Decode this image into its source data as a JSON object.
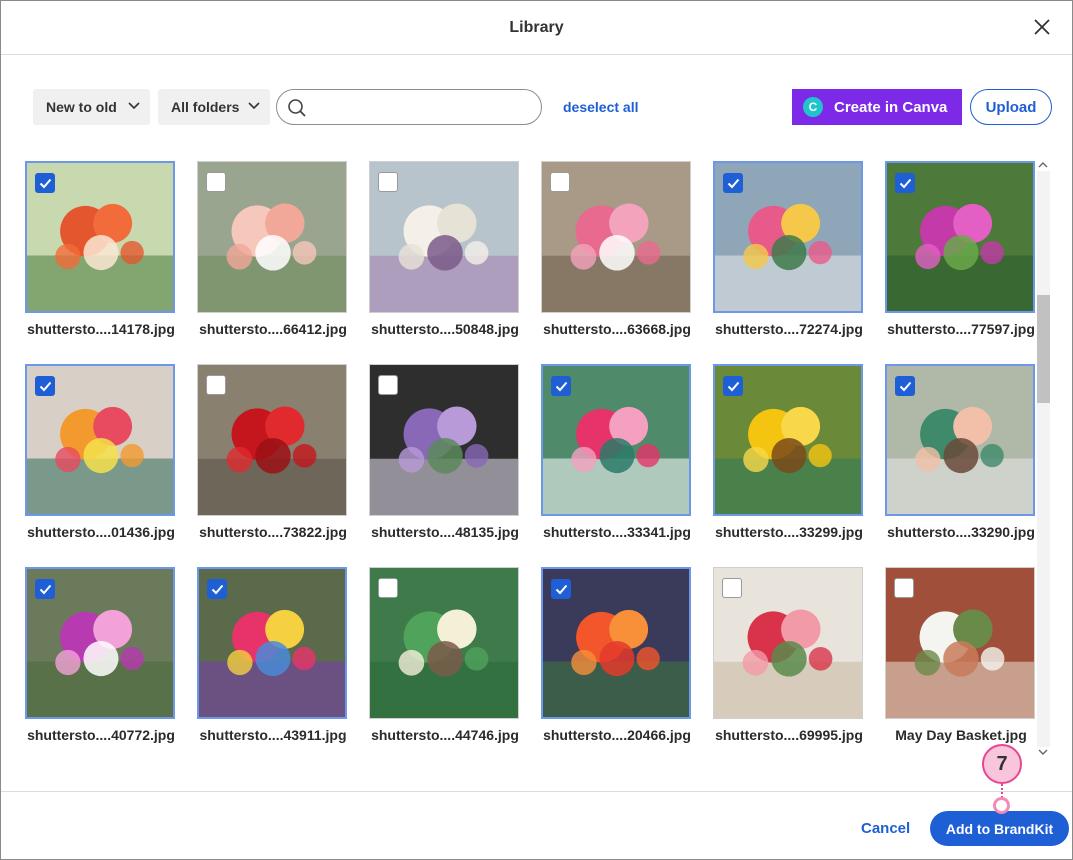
{
  "dialog": {
    "title": "Library"
  },
  "toolbar": {
    "sort_value": "New to old",
    "folder_value": "All folders",
    "search_value": "",
    "search_placeholder": "",
    "deselect_label": "deselect all",
    "canva_label": "Create in Canva",
    "canva_logo_letter": "C",
    "upload_label": "Upload"
  },
  "colors": {
    "accent": "#1f5fd6",
    "canva": "#7d2ae8",
    "canva_logo": "#20c4cb",
    "selection_border": "#6d97e8",
    "callout": "#e7458f"
  },
  "images": [
    {
      "name": "shuttersto....14178.jpg",
      "selected": true,
      "thumb": "florist with orange tulips"
    },
    {
      "name": "shuttersto....66412.jpg",
      "selected": false,
      "thumb": "pink rose bouquet"
    },
    {
      "name": "shuttersto....50848.jpg",
      "selected": false,
      "thumb": "bridal bouquet"
    },
    {
      "name": "shuttersto....63668.jpg",
      "selected": false,
      "thumb": "hands arranging peonies"
    },
    {
      "name": "shuttersto....72274.jpg",
      "selected": true,
      "thumb": "flower shop storefront"
    },
    {
      "name": "shuttersto....77597.jpg",
      "selected": true,
      "thumb": "florist with orchids"
    },
    {
      "name": "shuttersto....01436.jpg",
      "selected": true,
      "thumb": "smiling florist"
    },
    {
      "name": "shuttersto....73822.jpg",
      "selected": false,
      "thumb": "red roses"
    },
    {
      "name": "shuttersto....48135.jpg",
      "selected": false,
      "thumb": "purple arrangement"
    },
    {
      "name": "shuttersto....33341.jpg",
      "selected": true,
      "thumb": "florist holding bouquet"
    },
    {
      "name": "shuttersto....33299.jpg",
      "selected": true,
      "thumb": "sunflowers"
    },
    {
      "name": "shuttersto....33290.jpg",
      "selected": true,
      "thumb": "florist with customer"
    },
    {
      "name": "shuttersto....40772.jpg",
      "selected": true,
      "thumb": "flower market"
    },
    {
      "name": "shuttersto....43911.jpg",
      "selected": true,
      "thumb": "flower stall"
    },
    {
      "name": "shuttersto....44746.jpg",
      "selected": false,
      "thumb": "bridesmaids in green"
    },
    {
      "name": "shuttersto....20466.jpg",
      "selected": true,
      "thumb": "orange gerberas"
    },
    {
      "name": "shuttersto....69995.jpg",
      "selected": false,
      "thumb": "red tulips on paper"
    },
    {
      "name": "May Day Basket.jpg",
      "selected": false,
      "thumb": "lily of the valley by brick wall"
    }
  ],
  "footer": {
    "cancel_label": "Cancel",
    "add_label": "Add to BrandKit"
  },
  "callout": {
    "number": "7"
  }
}
